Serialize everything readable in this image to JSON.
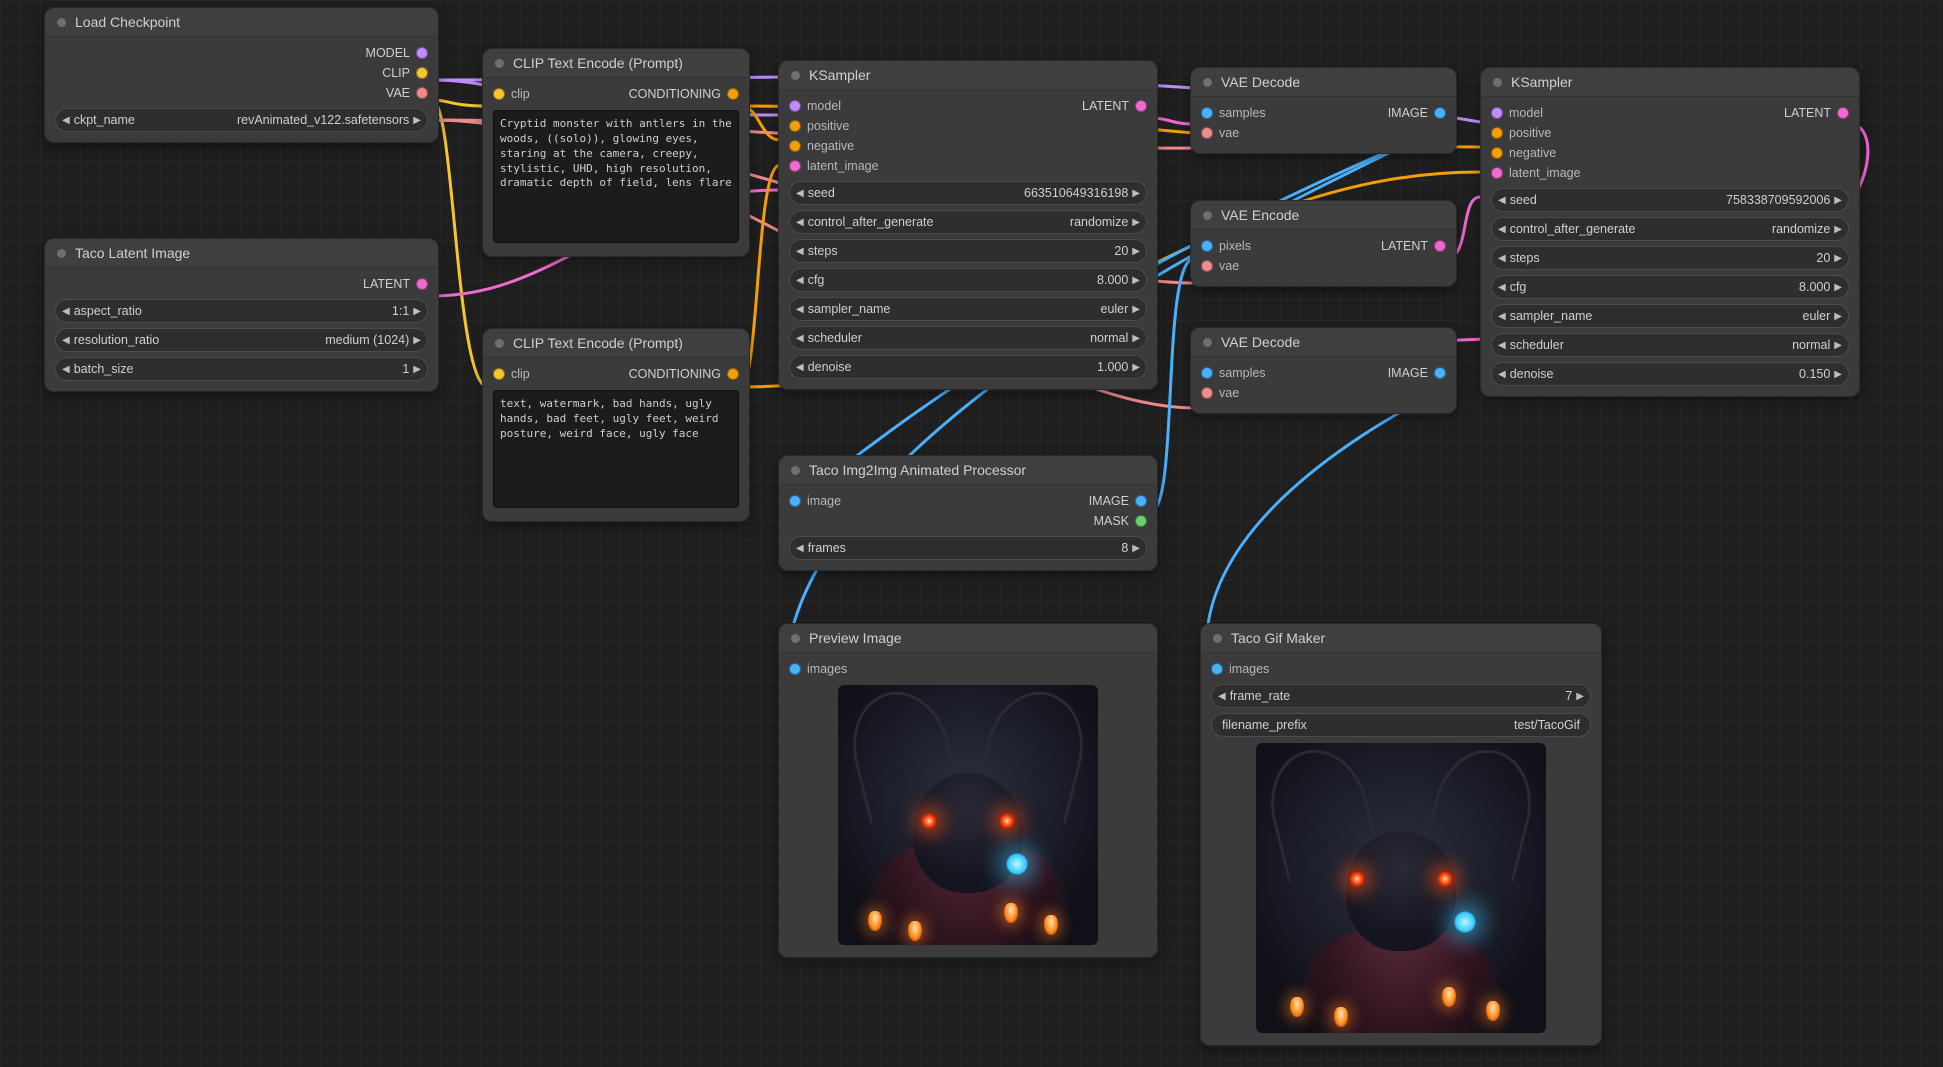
{
  "load_checkpoint": {
    "title": "Load Checkpoint",
    "out_model": "MODEL",
    "out_clip": "CLIP",
    "out_vae": "VAE",
    "ckpt_label": "ckpt_name",
    "ckpt_value": "revAnimated_v122.safetensors"
  },
  "taco_latent": {
    "title": "Taco Latent Image",
    "out_latent": "LATENT",
    "aspect_label": "aspect_ratio",
    "aspect_value": "1:1",
    "res_label": "resolution_ratio",
    "res_value": "medium (1024)",
    "batch_label": "batch_size",
    "batch_value": "1"
  },
  "clip_pos": {
    "title": "CLIP Text Encode (Prompt)",
    "in_clip": "clip",
    "out_cond": "CONDITIONING",
    "text": "Cryptid monster with antlers in the woods, ((solo)), glowing eyes, staring at the camera, creepy, stylistic, UHD, high resolution, dramatic depth of field, lens flare"
  },
  "clip_neg": {
    "title": "CLIP Text Encode (Prompt)",
    "in_clip": "clip",
    "out_cond": "CONDITIONING",
    "text": "text, watermark, bad hands, ugly hands, bad feet, ugly feet, weird posture, weird face, ugly face"
  },
  "ksampler1": {
    "title": "KSampler",
    "in_model": "model",
    "in_positive": "positive",
    "in_negative": "negative",
    "in_latent": "latent_image",
    "out_latent": "LATENT",
    "seed_label": "seed",
    "seed_value": "663510649316198",
    "cag_label": "control_after_generate",
    "cag_value": "randomize",
    "steps_label": "steps",
    "steps_value": "20",
    "cfg_label": "cfg",
    "cfg_value": "8.000",
    "sampler_label": "sampler_name",
    "sampler_value": "euler",
    "sched_label": "scheduler",
    "sched_value": "normal",
    "denoise_label": "denoise",
    "denoise_value": "1.000"
  },
  "vae_decode1": {
    "title": "VAE Decode",
    "in_samples": "samples",
    "in_vae": "vae",
    "out_image": "IMAGE"
  },
  "vae_encode": {
    "title": "VAE Encode",
    "in_pixels": "pixels",
    "in_vae": "vae",
    "out_latent": "LATENT"
  },
  "vae_decode2": {
    "title": "VAE Decode",
    "in_samples": "samples",
    "in_vae": "vae",
    "out_image": "IMAGE"
  },
  "taco_anim": {
    "title": "Taco Img2Img Animated Processor",
    "in_image": "image",
    "out_image": "IMAGE",
    "out_mask": "MASK",
    "frames_label": "frames",
    "frames_value": "8"
  },
  "preview": {
    "title": "Preview Image",
    "in_images": "images"
  },
  "ksampler2": {
    "title": "KSampler",
    "in_model": "model",
    "in_positive": "positive",
    "in_negative": "negative",
    "in_latent": "latent_image",
    "out_latent": "LATENT",
    "seed_label": "seed",
    "seed_value": "758338709592006",
    "cag_label": "control_after_generate",
    "cag_value": "randomize",
    "steps_label": "steps",
    "steps_value": "20",
    "cfg_label": "cfg",
    "cfg_value": "8.000",
    "sampler_label": "sampler_name",
    "sampler_value": "euler",
    "sched_label": "scheduler",
    "sched_value": "normal",
    "denoise_label": "denoise",
    "denoise_value": "0.150"
  },
  "gif_maker": {
    "title": "Taco Gif Maker",
    "in_images": "images",
    "fr_label": "frame_rate",
    "fr_value": "7",
    "fn_label": "filename_prefix",
    "fn_value": "test/TacoGif"
  }
}
